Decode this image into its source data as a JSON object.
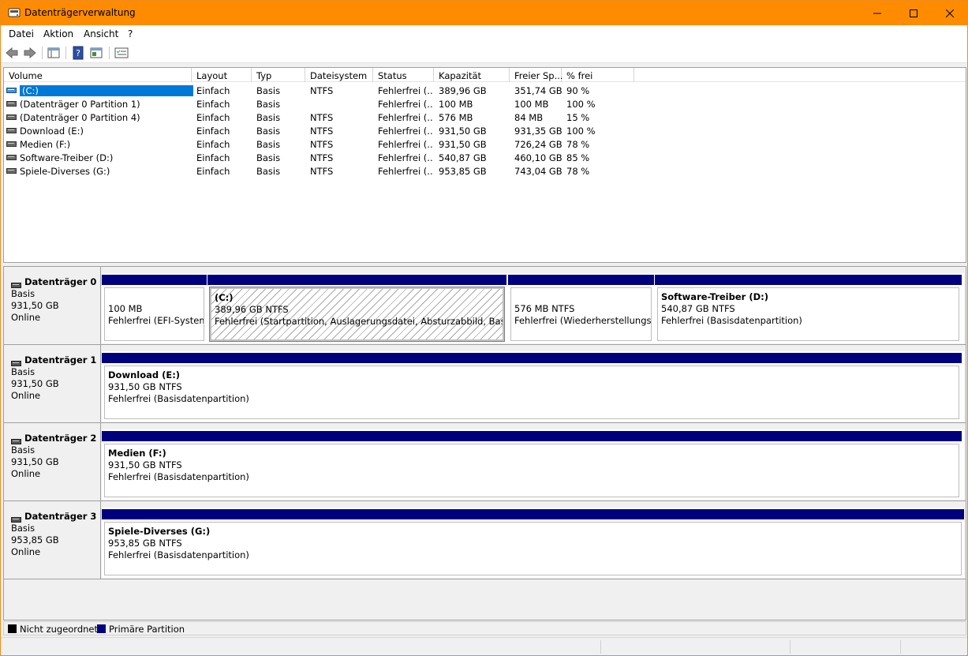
{
  "window": {
    "title": "Datenträgerverwaltung"
  },
  "menu": [
    "Datei",
    "Aktion",
    "Ansicht",
    "?"
  ],
  "columns": [
    "Volume",
    "Layout",
    "Typ",
    "Dateisystem",
    "Status",
    "Kapazität",
    "Freier Sp...",
    "% frei"
  ],
  "volumes": [
    {
      "volume": "(C:)",
      "layout": "Einfach",
      "typ": "Basis",
      "fs": "NTFS",
      "status": "Fehlerfrei (...",
      "cap": "389,96 GB",
      "free": "351,74 GB",
      "pct": "90 %",
      "selected": true
    },
    {
      "volume": "(Datenträger 0 Partition 1)",
      "layout": "Einfach",
      "typ": "Basis",
      "fs": "",
      "status": "Fehlerfrei (...",
      "cap": "100 MB",
      "free": "100 MB",
      "pct": "100 %"
    },
    {
      "volume": "(Datenträger 0 Partition 4)",
      "layout": "Einfach",
      "typ": "Basis",
      "fs": "NTFS",
      "status": "Fehlerfrei (...",
      "cap": "576 MB",
      "free": "84 MB",
      "pct": "15 %"
    },
    {
      "volume": "Download (E:)",
      "layout": "Einfach",
      "typ": "Basis",
      "fs": "NTFS",
      "status": "Fehlerfrei (...",
      "cap": "931,50 GB",
      "free": "931,35 GB",
      "pct": "100 %"
    },
    {
      "volume": "Medien (F:)",
      "layout": "Einfach",
      "typ": "Basis",
      "fs": "NTFS",
      "status": "Fehlerfrei (...",
      "cap": "931,50 GB",
      "free": "726,24 GB",
      "pct": "78 %"
    },
    {
      "volume": "Software-Treiber (D:)",
      "layout": "Einfach",
      "typ": "Basis",
      "fs": "NTFS",
      "status": "Fehlerfrei (...",
      "cap": "540,87 GB",
      "free": "460,10 GB",
      "pct": "85 %"
    },
    {
      "volume": "Spiele-Diverses (G:)",
      "layout": "Einfach",
      "typ": "Basis",
      "fs": "NTFS",
      "status": "Fehlerfrei (...",
      "cap": "953,85 GB",
      "free": "743,04 GB",
      "pct": "78 %"
    }
  ],
  "disks": [
    {
      "name": "Datenträger 0",
      "type": "Basis",
      "size": "931,50 GB",
      "state": "Online",
      "partitions": [
        {
          "name": "",
          "size": "100 MB",
          "status": "Fehlerfrei (EFI-Systempartition)",
          "hatched": false
        },
        {
          "name": "(C:)",
          "size": "389,96 GB NTFS",
          "status": "Fehlerfrei (Startpartition, Auslagerungsdatei, Absturzabbild, Basisdatenpartition)",
          "hatched": true
        },
        {
          "name": "",
          "size": "576 MB NTFS",
          "status": "Fehlerfrei (Wiederherstellungspartition)",
          "hatched": false
        },
        {
          "name": "Software-Treiber  (D:)",
          "size": "540,87 GB NTFS",
          "status": "Fehlerfrei (Basisdatenpartition)",
          "hatched": false
        }
      ]
    },
    {
      "name": "Datenträger 1",
      "type": "Basis",
      "size": "931,50 GB",
      "state": "Online",
      "partitions": [
        {
          "name": "Download  (E:)",
          "size": "931,50 GB NTFS",
          "status": "Fehlerfrei (Basisdatenpartition)",
          "hatched": false
        }
      ]
    },
    {
      "name": "Datenträger 2",
      "type": "Basis",
      "size": "931,50 GB",
      "state": "Online",
      "partitions": [
        {
          "name": "Medien  (F:)",
          "size": "931,50 GB NTFS",
          "status": "Fehlerfrei (Basisdatenpartition)",
          "hatched": false
        }
      ]
    },
    {
      "name": "Datenträger 3",
      "type": "Basis",
      "size": "953,85 GB",
      "state": "Online",
      "partitions": [
        {
          "name": "Spiele-Diverses  (G:)",
          "size": "953,85 GB NTFS",
          "status": "Fehlerfrei (Basisdatenpartition)",
          "hatched": false
        }
      ]
    }
  ],
  "legend": [
    {
      "label": "Nicht zugeordnet",
      "color": "#000000"
    },
    {
      "label": "Primäre Partition",
      "color": "#00007f"
    }
  ],
  "colors": {
    "titlebar": "#ff8c00",
    "partition_bar": "#00007f",
    "selection": "#0078d7"
  }
}
